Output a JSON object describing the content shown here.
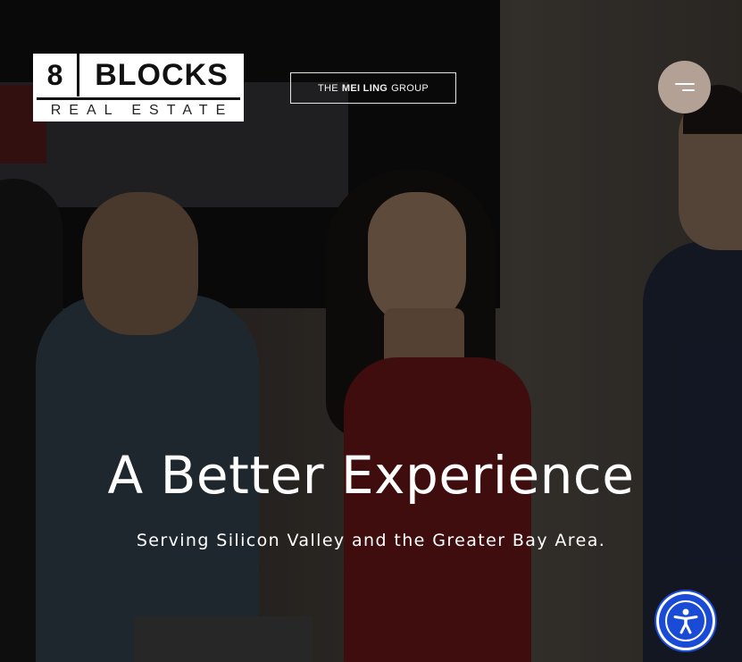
{
  "header": {
    "logo": {
      "number": "8",
      "word": "BLOCKS",
      "subtitle": "REAL ESTATE"
    },
    "group_badge": {
      "prefix": "THE",
      "name": "MEI LING",
      "suffix": "GROUP"
    },
    "menu_icon": "hamburger-icon"
  },
  "hero": {
    "headline": "A Better Experience",
    "subheadline": "Serving Silicon Valley and the Greater Bay Area."
  },
  "accessibility": {
    "icon": "accessibility-icon",
    "color": "#1a4bd6"
  },
  "colors": {
    "menu_button": "#b3a196",
    "logo_bg": "#ffffff",
    "text": "#ffffff"
  }
}
